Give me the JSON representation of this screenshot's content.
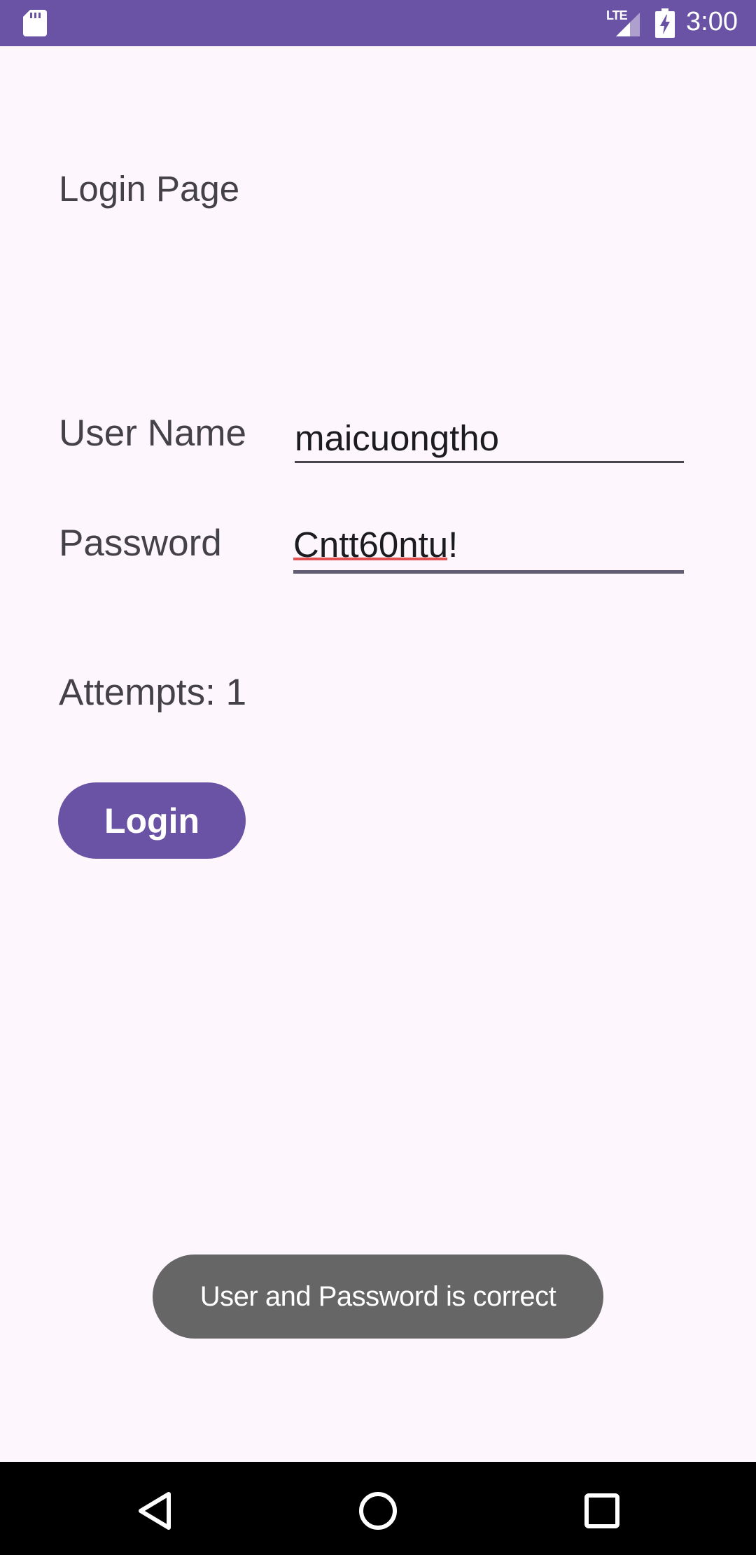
{
  "status_bar": {
    "time": "3:00",
    "network_label": "LTE",
    "background_color": "#6A52A5",
    "icons": [
      "sd-card-icon",
      "lte-signal-icon",
      "battery-charging-icon"
    ]
  },
  "page": {
    "title": "Login Page",
    "background_color": "#FDF7FD"
  },
  "form": {
    "username_label": "User Name",
    "username_value": "maicuongtho",
    "password_label": "Password",
    "password_value": "Cntt60ntu!",
    "attempts_text": "Attempts: 1",
    "login_label": "Login",
    "accent_color": "#6A52A5"
  },
  "toast": {
    "message": "User and Password is correct"
  },
  "nav_bar": {
    "icons": [
      "back-icon",
      "home-icon",
      "recents-icon"
    ]
  }
}
